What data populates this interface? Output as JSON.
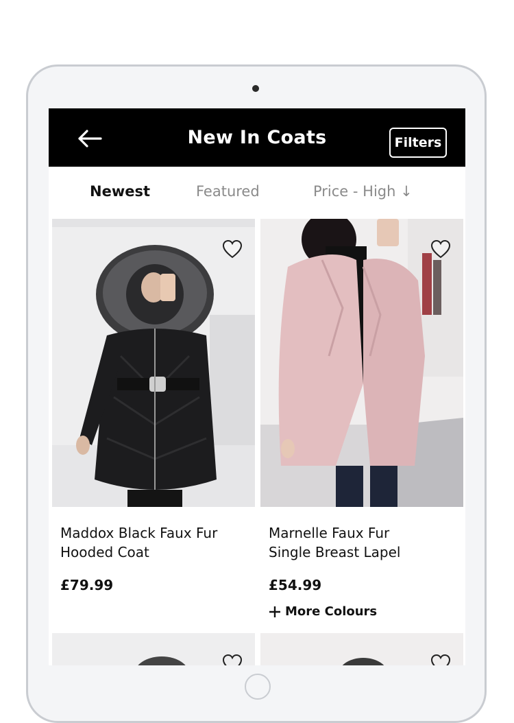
{
  "header": {
    "title": "New In Coats",
    "filters_label": "Filters"
  },
  "sort_tabs": [
    {
      "label": "Newest",
      "active": true
    },
    {
      "label": "Featured",
      "active": false
    },
    {
      "label": "Price - High ↓",
      "active": false
    }
  ],
  "products": [
    {
      "name_line1": "Maddox Black Faux Fur",
      "name_line2": "Hooded Coat",
      "price": "£79.99",
      "more_colours": ""
    },
    {
      "name_line1": "Marnelle Faux Fur",
      "name_line2": "Single Breast Lapel",
      "price": "£54.99",
      "more_colours": "More Colours"
    }
  ],
  "icons": {
    "back": "arrow-left-icon",
    "wishlist": "heart-icon",
    "plus": "plus-icon"
  },
  "colors": {
    "header_bg": "#000000",
    "header_text": "#ffffff",
    "active_tab": "#111111",
    "inactive_tab": "#8a8a8a"
  }
}
